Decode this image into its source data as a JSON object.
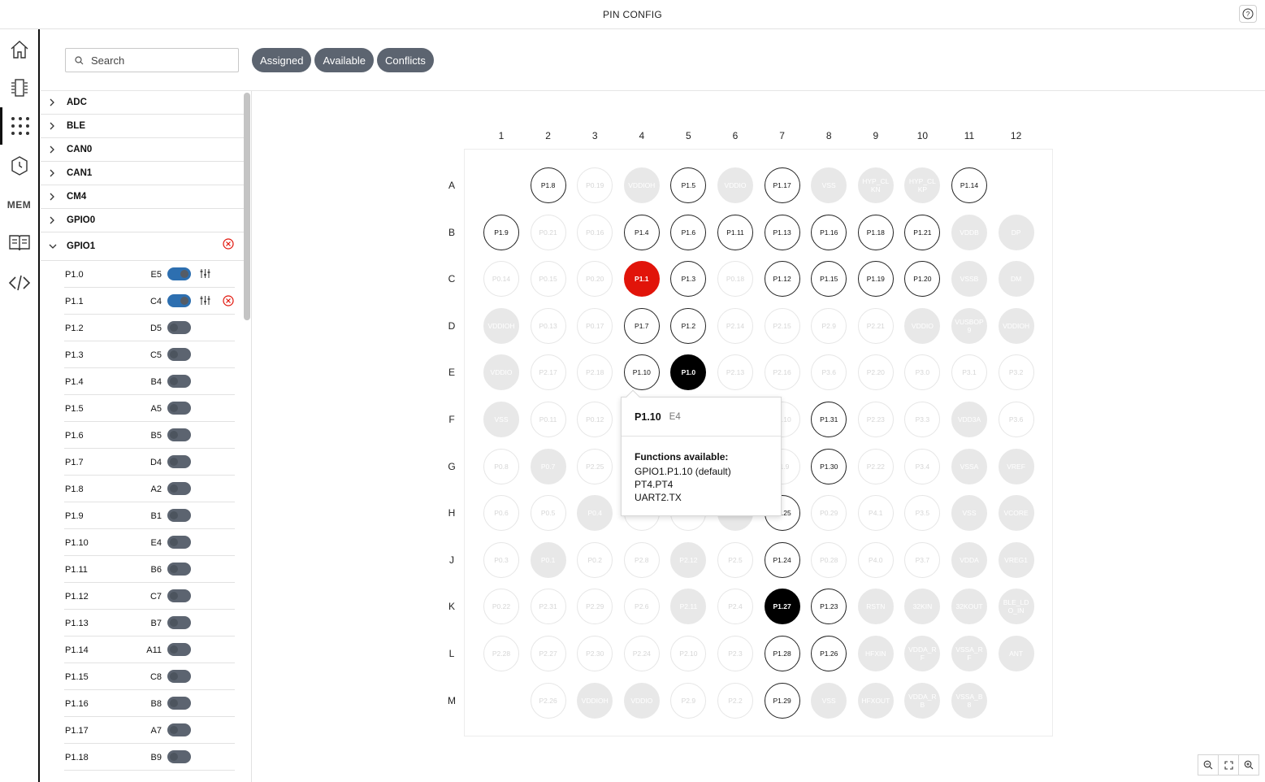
{
  "app": {
    "title": "PIN CONFIG"
  },
  "search": {
    "placeholder": "Search"
  },
  "filters": [
    "Assigned",
    "Available",
    "Conflicts"
  ],
  "groups": [
    "ADC",
    "BLE",
    "CAN0",
    "CAN1",
    "CM4",
    "GPIO0",
    "GPIO1"
  ],
  "gpio1_pins": [
    {
      "name": "P1.0",
      "loc": "E5",
      "enabled": true,
      "error": false
    },
    {
      "name": "P1.1",
      "loc": "C4",
      "enabled": true,
      "error": true
    },
    {
      "name": "P1.2",
      "loc": "D5",
      "enabled": false
    },
    {
      "name": "P1.3",
      "loc": "C5",
      "enabled": false
    },
    {
      "name": "P1.4",
      "loc": "B4",
      "enabled": false
    },
    {
      "name": "P1.5",
      "loc": "A5",
      "enabled": false
    },
    {
      "name": "P1.6",
      "loc": "B5",
      "enabled": false
    },
    {
      "name": "P1.7",
      "loc": "D4",
      "enabled": false
    },
    {
      "name": "P1.8",
      "loc": "A2",
      "enabled": false
    },
    {
      "name": "P1.9",
      "loc": "B1",
      "enabled": false
    },
    {
      "name": "P1.10",
      "loc": "E4",
      "enabled": false
    },
    {
      "name": "P1.11",
      "loc": "B6",
      "enabled": false
    },
    {
      "name": "P1.12",
      "loc": "C7",
      "enabled": false
    },
    {
      "name": "P1.13",
      "loc": "B7",
      "enabled": false
    },
    {
      "name": "P1.14",
      "loc": "A11",
      "enabled": false
    },
    {
      "name": "P1.15",
      "loc": "C8",
      "enabled": false
    },
    {
      "name": "P1.16",
      "loc": "B8",
      "enabled": false
    },
    {
      "name": "P1.17",
      "loc": "A7",
      "enabled": false
    },
    {
      "name": "P1.18",
      "loc": "B9",
      "enabled": false
    }
  ],
  "board": {
    "columns": [
      "1",
      "2",
      "3",
      "4",
      "5",
      "6",
      "7",
      "8",
      "9",
      "10",
      "11",
      "12"
    ],
    "rows": [
      "A",
      "B",
      "C",
      "D",
      "E",
      "F",
      "G",
      "H",
      "J",
      "K",
      "L",
      "M"
    ],
    "cells": [
      [
        "",
        "a:P1.8",
        "d:P0.19",
        "p:VDDIOH",
        "a:P1.5",
        "p:VDDIO",
        "a:P1.17",
        "p:VSS",
        "p:HYP_CLKN",
        "p:HYP_CLKP",
        "a:P1.14",
        ""
      ],
      [
        "a:P1.9",
        "d:P0.21",
        "d:P0.16",
        "a:P1.4",
        "a:P1.6",
        "a:P1.11",
        "a:P1.13",
        "a:P1.16",
        "a:P1.18",
        "a:P1.21",
        "p:VDDB",
        "p:DP"
      ],
      [
        "d:P0.14",
        "d:P0.15",
        "d:P0.20",
        "c:P1.1",
        "a:P1.3",
        "d:P0.18",
        "a:P1.12",
        "a:P1.15",
        "a:P1.19",
        "a:P1.20",
        "p:VSSB",
        "p:DM"
      ],
      [
        "p:VDDIOH",
        "d:P0.13",
        "d:P0.17",
        "a:P1.7",
        "a:P1.2",
        "d:P2.14",
        "d:P2.15",
        "d:P2.9",
        "d:P2.21",
        "p:VDDIO",
        "p:VUSBOP9",
        "p:VDDIOH"
      ],
      [
        "p:VDDIO",
        "d:P2.17",
        "d:P2.18",
        "a:P1.10",
        "s:P1.0",
        "d:P2.13",
        "d:P2.16",
        "d:P3.6",
        "d:P2.20",
        "d:P3.0",
        "d:P3.1",
        "d:P3.2"
      ],
      [
        "p:VSS",
        "d:P0.11",
        "d:P0.12",
        "",
        "",
        "",
        "d:P1.10",
        "a:P1.31",
        "d:P2.23",
        "d:P3.3",
        "p:VDD3A",
        "d:P3.6"
      ],
      [
        "d:P0.8",
        "p:P0.7",
        "d:P2.25",
        "",
        "",
        "",
        "d:P1.9",
        "a:P1.30",
        "d:P2.22",
        "d:P3.4",
        "p:VSSA",
        "p:VREF"
      ],
      [
        "d:P0.6",
        "d:P0.5",
        "p:P0.4",
        "d:P0.3",
        "d:P0.2",
        "p:P0.1",
        "a:P1.25",
        "d:P0.29",
        "d:P4.1",
        "d:P3.5",
        "p:VSS",
        "p:VCORE"
      ],
      [
        "d:P0.3",
        "p:P0.1",
        "d:P0.2",
        "d:P2.8",
        "p:P2.12",
        "d:P2.5",
        "a:P1.24",
        "d:P0.28",
        "d:P4.0",
        "d:P3.7",
        "p:VDDA",
        "p:VREG1"
      ],
      [
        "d:P0.22",
        "d:P2.31",
        "d:P2.29",
        "d:P2.6",
        "p:P2.11",
        "d:P2.4",
        "s:P1.27",
        "a:P1.23",
        "p:RSTN",
        "p:32KIN",
        "p:32KOUT",
        "p:BLE_LDO_IN"
      ],
      [
        "d:P2.28",
        "d:P2.27",
        "d:P2.30",
        "d:P2.24",
        "d:P2.10",
        "d:P2.3",
        "a:P1.28",
        "a:P1.26",
        "p:HFXIN",
        "p:VDDA_RF",
        "p:VSSA_RF",
        "p:ANT"
      ],
      [
        "",
        "d:P2.26",
        "p:VDDIOH",
        "p:VDDIO",
        "d:P2.9",
        "d:P2.2",
        "a:P1.29",
        "p:VSS",
        "p:HFXOUT",
        "p:VDDA_RB",
        "p:VSSA_B8",
        ""
      ]
    ]
  },
  "tooltip": {
    "pin": "P1.10",
    "location": "E4",
    "functions_header": "Functions available:",
    "functions": [
      "GPIO1.P1.10 (default)",
      "PT4.PT4",
      "UART2.TX"
    ]
  },
  "colors": {
    "conflict": "#e1140a",
    "selected": "#000000",
    "toggle_on": "#2d6fb0",
    "filter_button": "#5c6470"
  },
  "icons": [
    "home-icon",
    "peripherals-icon",
    "pin-config-icon",
    "clock-icon",
    "mem-icon",
    "docs-icon",
    "code-icon",
    "help-icon",
    "search-icon",
    "zoom-out-icon",
    "fullscreen-icon",
    "zoom-in-icon"
  ],
  "rail": {
    "mem_label": "MEM"
  }
}
